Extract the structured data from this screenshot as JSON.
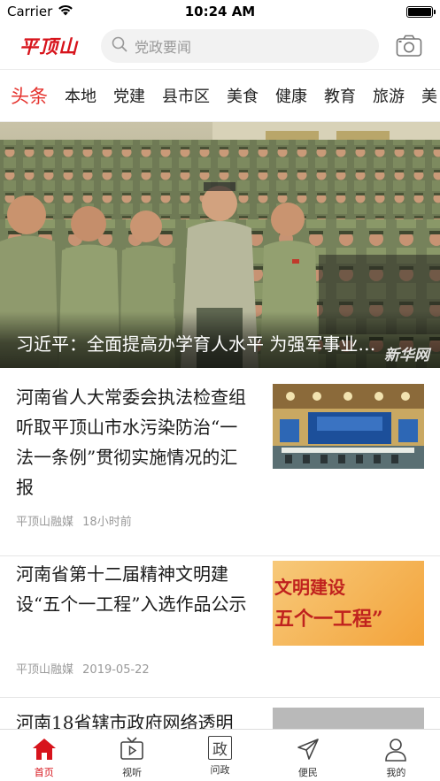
{
  "status_bar": {
    "carrier": "Carrier",
    "time": "10:24 AM"
  },
  "header": {
    "logo": "平顶山",
    "search_placeholder": "党政要闻"
  },
  "tabs": [
    "头条",
    "本地",
    "党建",
    "县市区",
    "美食",
    "健康",
    "教育",
    "旅游",
    "美"
  ],
  "hero": {
    "title": "习近平：全面提高办学育人水平 为强军事业提供有力人才支撑",
    "watermark": "新华网"
  },
  "news": [
    {
      "title": "河南省人大常委会执法检查组听取平顶山市水污染防治“一法一条例”贯彻实施情况的汇报",
      "source": "平顶山融媒",
      "time": "18小时前",
      "thumb_text": ""
    },
    {
      "title": "河南省第十二届精神文明建设“五个一工程”入选作品公示",
      "source": "平顶山融媒",
      "time": "2019-05-22",
      "thumb_text_1": "文明建设",
      "thumb_text_2": "五个一工程”"
    },
    {
      "title": "河南18省辖市政府网络透明",
      "source": "",
      "time": ""
    }
  ],
  "tabbar": [
    {
      "label": "首页",
      "icon": "home-icon"
    },
    {
      "label": "视听",
      "icon": "tv-icon"
    },
    {
      "label": "问政",
      "icon": "zheng-icon",
      "glyph": "政"
    },
    {
      "label": "便民",
      "icon": "send-icon"
    },
    {
      "label": "我的",
      "icon": "person-icon"
    }
  ],
  "colors": {
    "accent": "#e5322d",
    "brand": "#d7141c"
  }
}
